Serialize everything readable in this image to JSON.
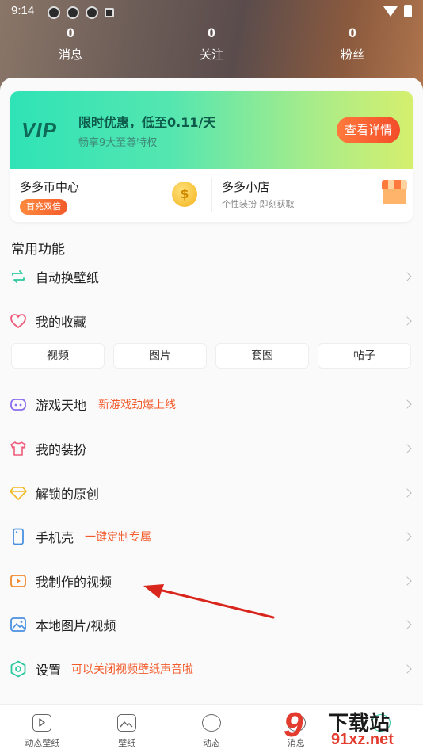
{
  "status": {
    "time": "9:14"
  },
  "stats": [
    {
      "num": "0",
      "label": "消息"
    },
    {
      "num": "0",
      "label": "关注"
    },
    {
      "num": "0",
      "label": "粉丝"
    }
  ],
  "vip": {
    "logo": "VIP",
    "title": "限时优惠，低至0.11/天",
    "subtitle": "畅享9大至尊特权",
    "button": "查看详情"
  },
  "coin_center": {
    "title": "多多币中心",
    "badge": "首充双倍",
    "icon": "coin-icon"
  },
  "shop": {
    "title": "多多小店",
    "subtitle": "个性装扮 即刻获取",
    "icon": "shop-icon"
  },
  "section_title": "常用功能",
  "menu": [
    {
      "label": "自动换壁纸",
      "icon": "refresh-icon",
      "color": "#2cc9a0"
    },
    {
      "label": "我的收藏",
      "icon": "heart-icon",
      "color": "#ef5a7a"
    },
    {
      "label": "游戏天地",
      "tag": "新游戏劲爆上线",
      "icon": "gamepad-icon",
      "color": "#8a6cf0"
    },
    {
      "label": "我的装扮",
      "icon": "shirt-icon",
      "color": "#ef5a7a"
    },
    {
      "label": "解锁的原创",
      "icon": "diamond-icon",
      "color": "#f2b822"
    },
    {
      "label": "手机壳",
      "tag": "一键定制专属",
      "icon": "phone-icon",
      "color": "#4a90e2"
    },
    {
      "label": "我制作的视频",
      "icon": "video-icon",
      "color": "#f28a2a"
    },
    {
      "label": "本地图片/视频",
      "icon": "image-icon",
      "color": "#4a90e2"
    },
    {
      "label": "设置",
      "tag": "可以关闭视频壁纸声音啦",
      "icon": "settings-icon",
      "color": "#2cc9a0"
    }
  ],
  "chips": [
    "视频",
    "图片",
    "套图",
    "帖子"
  ],
  "tabs": [
    {
      "label": "动态壁纸",
      "icon": "play-icon"
    },
    {
      "label": "壁纸",
      "icon": "picture-icon"
    },
    {
      "label": "动态",
      "icon": "planet-icon"
    },
    {
      "label": "消息",
      "icon": "message-icon"
    },
    {
      "label": "",
      "icon": "profile-icon"
    }
  ],
  "watermark": {
    "digits": "9",
    "text": "下载站",
    "url": "91xz.net"
  },
  "accent": "#f25a2a"
}
